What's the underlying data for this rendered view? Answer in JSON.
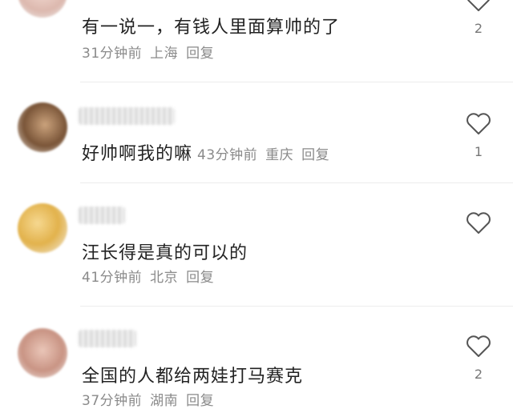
{
  "comments": [
    {
      "text": "有一说一，有钱人里面算帅的了",
      "time": "31分钟前",
      "location": "上海",
      "reply_label": "回复",
      "likes": "2",
      "avatar_color": "#e8c8c0"
    },
    {
      "text": "好帅啊我的嘛",
      "time": "43分钟前",
      "location": "重庆",
      "reply_label": "回复",
      "likes": "1",
      "avatar_color": "#8a6a50"
    },
    {
      "text": "汪长得是真的可以的",
      "time": "41分钟前",
      "location": "北京",
      "reply_label": "回复",
      "likes": "",
      "avatar_color": "#e6c070"
    },
    {
      "text": "全国的人都给两娃打马赛克",
      "time": "37分钟前",
      "location": "湖南",
      "reply_label": "回复",
      "likes": "2",
      "avatar_color": "#d9b0a0"
    }
  ],
  "icons": {
    "like": "heart-outline-icon"
  }
}
